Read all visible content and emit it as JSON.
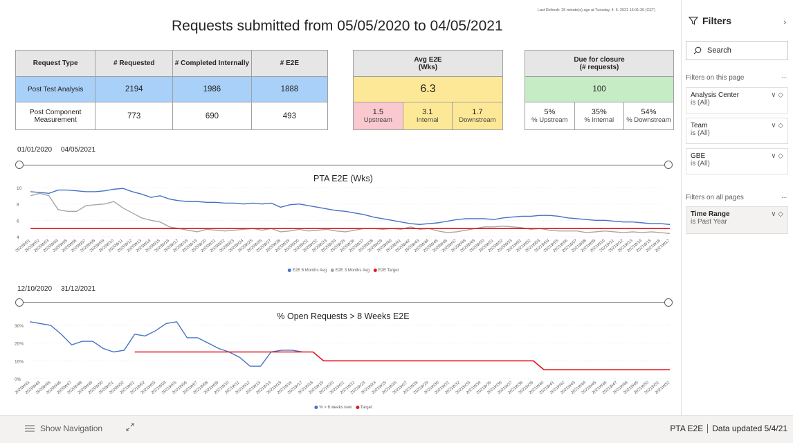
{
  "report": {
    "title": "Requests submitted from  05/05/2020  to  04/05/2021",
    "last_refresh": "Last Refresh: 25 minute(s) ago at Tuesday, 4. 5. 2021 16:01:39 (CET)"
  },
  "table1": {
    "headers": [
      "Request Type",
      "# Requested",
      "# Completed Internally",
      "# E2E"
    ],
    "rows": [
      [
        "Post Test Analysis",
        "2194",
        "1986",
        "1888"
      ],
      [
        "Post Component Measurement",
        "773",
        "690",
        "493"
      ]
    ]
  },
  "avg_e2e": {
    "header_line1": "Avg E2E",
    "header_line2": "(Wks)",
    "value": "6.3",
    "parts": [
      {
        "value": "1.5",
        "label": "Upstream"
      },
      {
        "value": "3.1",
        "label": "Internal"
      },
      {
        "value": "1.7",
        "label": "Downstream"
      }
    ]
  },
  "due": {
    "header_line1": "Due for closure",
    "header_line2": "(# requests)",
    "value": "100",
    "parts": [
      {
        "value": "5%",
        "label": "% Upstream"
      },
      {
        "value": "35%",
        "label": "% Internal"
      },
      {
        "value": "54%",
        "label": "% Downstream"
      }
    ]
  },
  "slicer1": {
    "start": "01/01/2020",
    "end": "04/05/2021"
  },
  "slicer2": {
    "start": "12/10/2020",
    "end": "31/12/2021"
  },
  "chart_data": [
    {
      "type": "line",
      "title": "PTA E2E (Wks)",
      "ylim": [
        4,
        10
      ],
      "yticks": [
        4,
        6,
        8,
        10
      ],
      "categories": [
        "2020W01",
        "2020W02",
        "2020W03",
        "2020W04",
        "2020W05",
        "2020W06",
        "2020W07",
        "2020W08",
        "2020W09",
        "2020W10",
        "2020W11",
        "2020W12",
        "2020W13",
        "2020W14",
        "2020W15",
        "2020W16",
        "2020W17",
        "2020W18",
        "2020W19",
        "2020W20",
        "2020W21",
        "2020W22",
        "2020W23",
        "2020W24",
        "2020W25",
        "2020W26",
        "2020W27",
        "2020W28",
        "2020W29",
        "2020W30",
        "2020W31",
        "2020W32",
        "2020W33",
        "2020W34",
        "2020W35",
        "2020W36",
        "2020W37",
        "2020W38",
        "2020W39",
        "2020W40",
        "2020W41",
        "2020W42",
        "2020W43",
        "2020W44",
        "2020W45",
        "2020W46",
        "2020W47",
        "2020W48",
        "2020W49",
        "2020W50",
        "2020W51",
        "2020W52",
        "2020W53",
        "2021W01",
        "2021W02",
        "2021W03",
        "2021W04",
        "2021W05",
        "2021W06",
        "2021W07",
        "2021W08",
        "2021W09",
        "2021W10",
        "2021W11",
        "2021W12",
        "2021W13",
        "2021W14",
        "2021W15",
        "2021W16",
        "2021W17"
      ],
      "series": [
        {
          "name": "E2E 6 Months Avg",
          "color": "#4472c4",
          "values": [
            9.5,
            9.4,
            9.3,
            9.7,
            9.7,
            9.6,
            9.5,
            9.5,
            9.6,
            9.8,
            9.9,
            9.5,
            9.2,
            8.8,
            9.0,
            8.6,
            8.4,
            8.3,
            8.3,
            8.2,
            8.2,
            8.1,
            8.1,
            8.0,
            8.1,
            8.0,
            8.1,
            7.6,
            7.9,
            8.0,
            7.8,
            7.6,
            7.4,
            7.2,
            7.1,
            6.9,
            6.7,
            6.4,
            6.2,
            6.0,
            5.8,
            5.6,
            5.5,
            5.6,
            5.7,
            5.9,
            6.1,
            6.2,
            6.2,
            6.2,
            6.1,
            6.3,
            6.4,
            6.5,
            6.5,
            6.6,
            6.6,
            6.5,
            6.3,
            6.2,
            6.1,
            6.0,
            6.0,
            5.9,
            5.8,
            5.8,
            5.7,
            5.6,
            5.6,
            5.5
          ]
        },
        {
          "name": "E2E 3 Months Avg",
          "color": "#a6a6a6",
          "values": [
            9.0,
            9.3,
            9.0,
            7.3,
            7.1,
            7.1,
            7.8,
            7.9,
            8.0,
            8.3,
            7.5,
            6.9,
            6.3,
            6.0,
            5.8,
            5.2,
            5.0,
            4.8,
            4.6,
            4.9,
            4.8,
            4.7,
            4.8,
            4.9,
            5.0,
            4.8,
            5.0,
            4.6,
            4.7,
            4.9,
            4.7,
            4.8,
            4.9,
            4.7,
            4.6,
            4.8,
            5.0,
            5.0,
            4.9,
            5.0,
            4.9,
            5.2,
            4.9,
            5.0,
            4.7,
            4.5,
            4.6,
            4.8,
            5.0,
            5.2,
            5.2,
            5.3,
            5.2,
            5.1,
            4.9,
            5.0,
            4.8,
            4.7,
            4.7,
            4.7,
            4.5,
            4.6,
            4.7,
            4.6,
            4.5,
            4.6,
            4.5,
            4.6,
            4.5,
            4.4
          ]
        },
        {
          "name": "E2E Target",
          "color": "#e3161e",
          "values": [
            5,
            5,
            5,
            5,
            5,
            5,
            5,
            5,
            5,
            5,
            5,
            5,
            5,
            5,
            5,
            5,
            5,
            5,
            5,
            5,
            5,
            5,
            5,
            5,
            5,
            5,
            5,
            5,
            5,
            5,
            5,
            5,
            5,
            5,
            5,
            5,
            5,
            5,
            5,
            5,
            5,
            5,
            5,
            5,
            5,
            5,
            5,
            5,
            5,
            5,
            5,
            5,
            5,
            5,
            5,
            5,
            5,
            5,
            5,
            5,
            5,
            5,
            5,
            5,
            5,
            5,
            5,
            5,
            5,
            5
          ]
        }
      ]
    },
    {
      "type": "line",
      "title": "% Open Requests > 8 Weeks E2E",
      "ylim": [
        0,
        30
      ],
      "yticks": [
        "0%",
        "10%",
        "20%",
        "30%"
      ],
      "yvals": [
        0,
        10,
        20,
        30
      ],
      "categories": [
        "2020W43",
        "2020W44",
        "2020W45",
        "2020W46",
        "2020W47",
        "2020W48",
        "2020W49",
        "2020W50",
        "2020W51",
        "2020W52",
        "2021W01",
        "2021W02",
        "2021W03",
        "2021W04",
        "2021W05",
        "2021W06",
        "2021W07",
        "2021W08",
        "2021W09",
        "2021W10",
        "2021W11",
        "2021W12",
        "2021W13",
        "2021W14",
        "2021W15",
        "2021W16",
        "2021W17",
        "2021W18",
        "2021W19",
        "2021W20",
        "2021W21",
        "2021W22",
        "2021W23",
        "2021W24",
        "2021W25",
        "2021W26",
        "2021W27",
        "2021W28",
        "2021W29",
        "2021W30",
        "2021W31",
        "2021W32",
        "2021W33",
        "2021W34",
        "2021W35",
        "2021W36",
        "2021W37",
        "2021W38",
        "2021W39",
        "2021W40",
        "2021W41",
        "2021W42",
        "2021W43",
        "2021W44",
        "2021W45",
        "2021W46",
        "2021W47",
        "2021W48",
        "2021W49",
        "2021W50",
        "2021W51",
        "2021W52"
      ],
      "series": [
        {
          "name": "% > 8 weeks new",
          "color": "#4472c4",
          "values": [
            32,
            31,
            30,
            25,
            19,
            21,
            21,
            17,
            15,
            16,
            25,
            24,
            27,
            31,
            32,
            23,
            23,
            20,
            17,
            15,
            12,
            7,
            7,
            15,
            16,
            16,
            15
          ]
        },
        {
          "name": "Target",
          "color": "#e3161e",
          "values": [
            null,
            null,
            null,
            null,
            null,
            null,
            null,
            null,
            null,
            null,
            15,
            15,
            15,
            15,
            15,
            15,
            15,
            15,
            15,
            15,
            15,
            15,
            15,
            15,
            15,
            15,
            15,
            15,
            10,
            10,
            10,
            10,
            10,
            10,
            10,
            10,
            10,
            10,
            10,
            10,
            10,
            10,
            10,
            10,
            10,
            10,
            10,
            10,
            10,
            5,
            5,
            5,
            5,
            5,
            5,
            5,
            5,
            5,
            5,
            5,
            5,
            5
          ]
        }
      ]
    }
  ],
  "filters": {
    "title": "Filters",
    "search_placeholder": "Search",
    "on_this_page": "Filters on this page",
    "on_all_pages": "Filters on all pages",
    "more": "...",
    "page_filters": [
      {
        "name": "Analysis Center",
        "value": "is (All)"
      },
      {
        "name": "Team",
        "value": "is (All)"
      },
      {
        "name": "GBE",
        "value": "is (All)"
      }
    ],
    "all_filters": [
      {
        "name": "Time Range",
        "value": "is Past Year"
      }
    ]
  },
  "bottom": {
    "show_navigation": "Show Navigation",
    "page_name": "PTA E2E",
    "data_updated": "Data updated 5/4/21"
  }
}
